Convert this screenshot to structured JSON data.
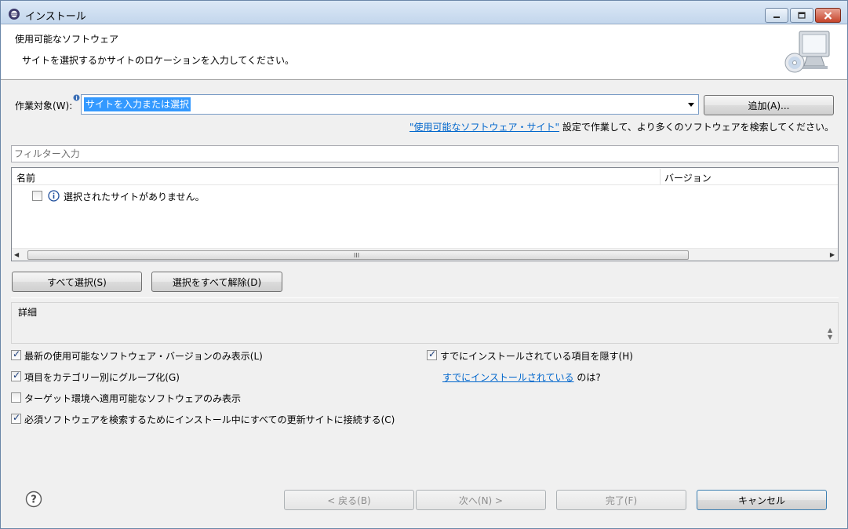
{
  "window": {
    "title": "インストール"
  },
  "header": {
    "title": "使用可能なソフトウェア",
    "description": "サイトを選択するかサイトのロケーションを入力してください。"
  },
  "work_with": {
    "label": "作業対象(W):",
    "value": "サイトを入力または選択",
    "add_label": "追加(A)..."
  },
  "sites_hint": {
    "link": "\"使用可能なソフトウェア・サイト\"",
    "text": " 設定で作業して、より多くのソフトウェアを検索してください。"
  },
  "filter": {
    "placeholder": "フィルター入力"
  },
  "table": {
    "columns": [
      "名前",
      "バージョン"
    ],
    "rows": [
      {
        "checked": false,
        "icon": "info-icon",
        "text": "選択されたサイトがありません。"
      }
    ],
    "scroll_grip": "III"
  },
  "buttons": {
    "select_all": "すべて選択(S)",
    "deselect_all": "選択をすべて解除(D)"
  },
  "details": {
    "label": "詳細"
  },
  "options": {
    "latest": {
      "label": "最新の使用可能なソフトウェア・バージョンのみ表示(L)",
      "checked": true
    },
    "group": {
      "label": "項目をカテゴリー別にグループ化(G)",
      "checked": true
    },
    "target": {
      "label": "ターゲット環境へ適用可能なソフトウェアのみ表示",
      "checked": false
    },
    "contact": {
      "label": "必須ソフトウェアを検索するためにインストール中にすべての更新サイトに接続する(C)",
      "checked": true
    },
    "hide": {
      "label": "すでにインストールされている項目を隠す(H)",
      "checked": true
    }
  },
  "installed_hint": {
    "link": "すでにインストールされている",
    "text": " のは?"
  },
  "footer": {
    "back": "< 戻る(B)",
    "next": "次へ(N) >",
    "finish": "完了(F)",
    "cancel": "キャンセル"
  },
  "colors": {
    "link": "#0066cc",
    "selection": "#3399ff",
    "titlebar": "#c3d6ec"
  }
}
